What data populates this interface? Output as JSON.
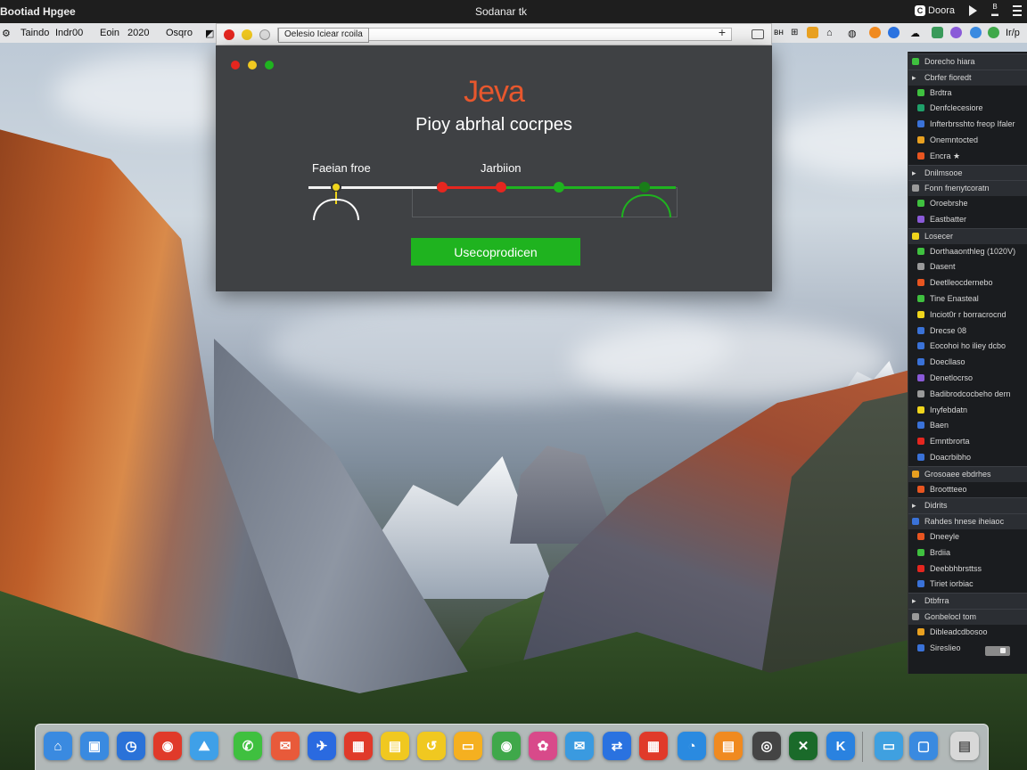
{
  "menubar": {
    "app_title": "Bootiad Hpgee",
    "window_title": "Sodanar tk",
    "right_btn_label": "Doora",
    "right_stack_label": "B"
  },
  "menurow": {
    "items": [
      "Taindo",
      "Indr00",
      "Eoin",
      "2020",
      "Osqro"
    ],
    "right_text": "Ir/p"
  },
  "browser": {
    "url_tab_label": "Oelesio Iciear rcoila"
  },
  "app": {
    "logo": "Jeva",
    "subtitle": "Pioy abrhal cocrpes",
    "label_left": "Faeian froe",
    "label_mid": "Jarbiion",
    "action_button": "Usecoprodicen",
    "track_colors": {
      "yellow": "#f0d51c",
      "red": "#e5261f",
      "green": "#1fb31f"
    }
  },
  "sidebar": {
    "rows": [
      {
        "label": "Dorecho hiara",
        "color": "#3fc03f",
        "header": true
      },
      {
        "label": "Cbrfer fioredt",
        "color": "",
        "header": true
      },
      {
        "label": "Brdtra",
        "color": "#3fc03f",
        "header": false
      },
      {
        "label": "Denfclecesiore",
        "color": "#1fa06a",
        "header": false
      },
      {
        "label": "Infterbrsshto freop Ifaler",
        "color": "#3a72d8",
        "header": false
      },
      {
        "label": "Onemntocted",
        "color": "#e8a020",
        "header": false
      },
      {
        "label": "Encra ★",
        "color": "#e85520",
        "header": false
      },
      {
        "label": "Dnilmsooe",
        "color": "",
        "header": true
      },
      {
        "label": "Fonn fnenytcoratn",
        "color": "#9a9a9a",
        "header": true
      },
      {
        "label": "Oroebrshe",
        "color": "#3fc03f",
        "header": false
      },
      {
        "label": "Eastbatter",
        "color": "#8a5ad8",
        "header": false
      },
      {
        "label": "Losecer",
        "color": "#f0d51c",
        "header": true
      },
      {
        "label": "Dorthaaonthleg (1020V)",
        "color": "#3fc03f",
        "header": false
      },
      {
        "label": "Dasent",
        "color": "#9a9a9a",
        "header": false
      },
      {
        "label": "Deetlleocdernebo",
        "color": "#e85520",
        "header": false
      },
      {
        "label": "Tine Enasteal",
        "color": "#3fc03f",
        "header": false
      },
      {
        "label": "Inciot0r r borracrocnd",
        "color": "#f0d51c",
        "header": false
      },
      {
        "label": "Drecse 08",
        "color": "#3a72d8",
        "header": false
      },
      {
        "label": "Eocohoi ho iliey dcbo",
        "color": "#3a72d8",
        "header": false
      },
      {
        "label": "Doecllaso",
        "color": "#3a72d8",
        "header": false
      },
      {
        "label": "Denetlocrso",
        "color": "#8a5ad8",
        "header": false
      },
      {
        "label": "Badibrodcocbeho dern",
        "color": "#9a9a9a",
        "header": false
      },
      {
        "label": "Inyfebdatn",
        "color": "#f0d51c",
        "header": false
      },
      {
        "label": "Baen",
        "color": "#3a72d8",
        "header": false
      },
      {
        "label": "Emntbrorta",
        "color": "#e5261f",
        "header": false
      },
      {
        "label": "Doacrbibho",
        "color": "#3a72d8",
        "header": false
      },
      {
        "label": "Grosoaee ebdrhes",
        "color": "#e8a020",
        "header": true
      },
      {
        "label": "Broottteeo",
        "color": "#e85520",
        "header": false
      },
      {
        "label": "Didrits",
        "color": "",
        "header": true
      },
      {
        "label": "Rahdes hnese iheiaoc",
        "color": "#3a72d8",
        "header": true
      },
      {
        "label": "Dneeyle",
        "color": "#e85520",
        "header": false
      },
      {
        "label": "Brdiia",
        "color": "#3fc03f",
        "header": false
      },
      {
        "label": "Deebbhbrsttss",
        "color": "#e5261f",
        "header": false
      },
      {
        "label": "Tiriet iorbiac",
        "color": "#3a72d8",
        "header": false
      },
      {
        "label": "Dtbfrra",
        "color": "",
        "header": true
      },
      {
        "label": "Gonbelocl tom",
        "color": "#9a9a9a",
        "header": true
      },
      {
        "label": "Dibleadcdbosoo",
        "color": "#e8a020",
        "header": false
      },
      {
        "label": "Sireslieo",
        "color": "#3a72d8",
        "header": false
      }
    ]
  },
  "dock": {
    "icons": [
      {
        "name": "home-app-icon",
        "color": "#3a8ae0",
        "glyph": "⌂"
      },
      {
        "name": "monitor-app-icon",
        "color": "#3a8ae0",
        "glyph": "▣"
      },
      {
        "name": "clock-app-icon",
        "color": "#2a72d8",
        "glyph": "◷"
      },
      {
        "name": "chrome-app-icon",
        "color": "#e03a2a",
        "glyph": "◉"
      },
      {
        "name": "photos-app-icon",
        "color": "#3fa0e8",
        "glyph": "⛰"
      },
      {
        "name": "facetime-app-icon",
        "color": "#3fc03f",
        "glyph": "✆"
      },
      {
        "name": "mail-app-icon",
        "color": "#e85a3a",
        "glyph": "✉"
      },
      {
        "name": "xcode-app-icon",
        "color": "#2a6ae0",
        "glyph": "✈"
      },
      {
        "name": "calendar-app-icon",
        "color": "#e03a2a",
        "glyph": "▦"
      },
      {
        "name": "notes-app-icon",
        "color": "#f0c820",
        "glyph": "▤"
      },
      {
        "name": "shortcut-app-icon",
        "color": "#f0c820",
        "glyph": "↺"
      },
      {
        "name": "files-app-icon",
        "color": "#f5b020",
        "glyph": "▭"
      },
      {
        "name": "chrome-2-app-icon",
        "color": "#3fa84a",
        "glyph": "◉"
      },
      {
        "name": "gallery-app-icon",
        "color": "#d84a8a",
        "glyph": "✿"
      },
      {
        "name": "messages-app-icon",
        "color": "#3a9ae0",
        "glyph": "✉"
      },
      {
        "name": "appstore-app-icon",
        "color": "#2a72e0",
        "glyph": "⇄"
      },
      {
        "name": "grid-app-icon",
        "color": "#e03a2a",
        "glyph": "▦"
      },
      {
        "name": "timer-app-icon",
        "color": "#2a8ae0",
        "glyph": "◔"
      },
      {
        "name": "doc-app-icon",
        "color": "#f08a20",
        "glyph": "▤"
      },
      {
        "name": "power-app-icon",
        "color": "#444444",
        "glyph": "◎"
      },
      {
        "name": "xbox-app-icon",
        "color": "#1a6a2a",
        "glyph": "✕"
      },
      {
        "name": "k-app-icon",
        "color": "#2a82e0",
        "glyph": "K"
      },
      {
        "name": "folder-app-icon",
        "color": "#3fa0e0",
        "glyph": "▭"
      },
      {
        "name": "window-app-icon",
        "color": "#3a8ae0",
        "glyph": "▢"
      },
      {
        "name": "trash-app-icon",
        "color": "#d8d8d8",
        "glyph": "▤"
      }
    ]
  }
}
